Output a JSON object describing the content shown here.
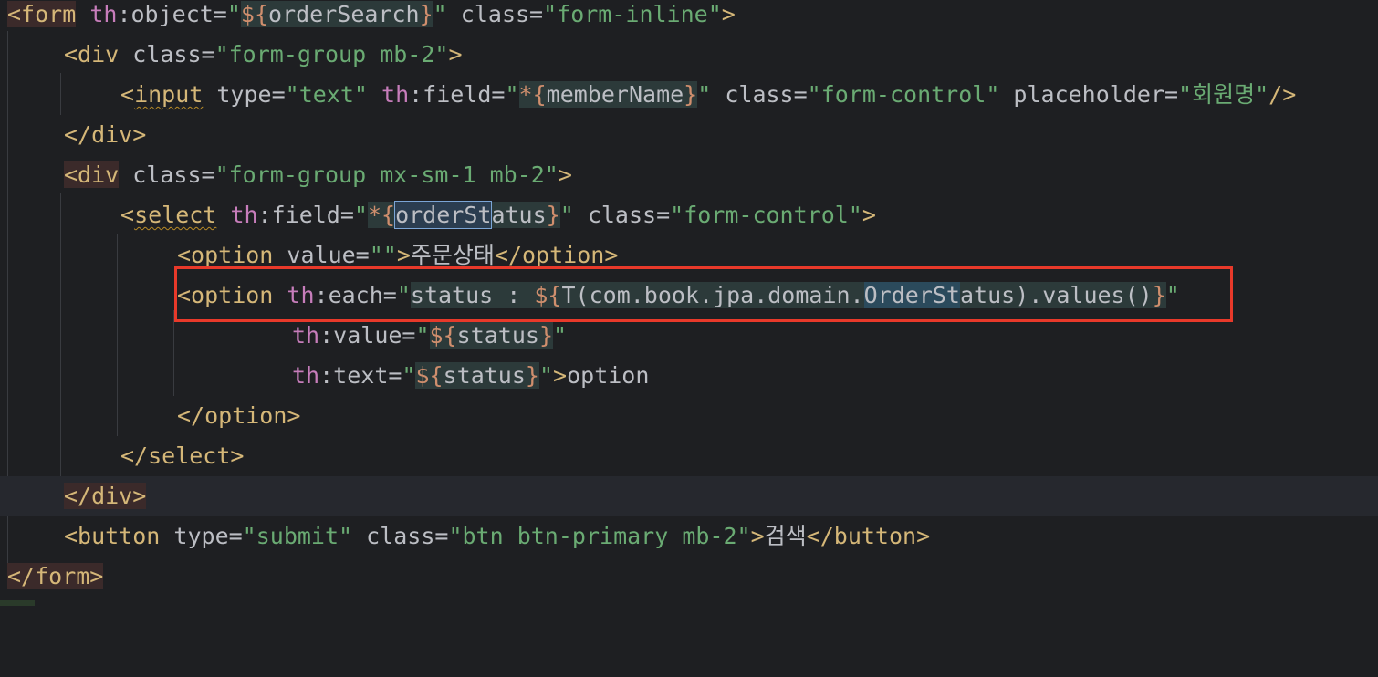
{
  "editor": {
    "lines": [
      {
        "tokens": [
          "<form",
          " ",
          "th",
          ":object=",
          "\"",
          "${",
          "orderSearch",
          "}",
          "\"",
          " class=",
          "\"form-inline\"",
          ">"
        ]
      },
      {
        "tokens": [
          "<div",
          " class=",
          "\"form-group mb-2\"",
          ">"
        ]
      },
      {
        "tokens": [
          "<",
          "input",
          " type=",
          "\"text\"",
          " ",
          "th",
          ":field=",
          "\"",
          "*{",
          "memberName",
          "}",
          "\"",
          " class=",
          "\"form-control\"",
          " placeholder=",
          "\"회원명\"",
          "/>"
        ]
      },
      {
        "tokens": [
          "</div>"
        ]
      },
      {
        "tokens": [
          "<div",
          " class=",
          "\"form-group mx-sm-1 mb-2\"",
          ">"
        ]
      },
      {
        "tokens": [
          "<",
          "select",
          " ",
          "th",
          ":field=",
          "\"",
          "*{",
          "orderSt",
          "atus",
          "}",
          "\"",
          " class=",
          "\"form-control\"",
          ">"
        ]
      },
      {
        "tokens": [
          "<option",
          " value=",
          "\"\"",
          ">",
          "주문상태",
          "</option>"
        ]
      },
      {
        "tokens": [
          "<option",
          " ",
          "th",
          ":each=",
          "\"",
          "status : ",
          "${",
          "T(com.book.jpa.domain.",
          "OrderSt",
          "atus).values()",
          "}",
          "\""
        ]
      },
      {
        "tokens": [
          "th",
          ":value=",
          "\"",
          "${",
          "status",
          "}",
          "\""
        ]
      },
      {
        "tokens": [
          "th",
          ":text=",
          "\"",
          "${",
          "status",
          "}",
          "\"",
          ">",
          "option"
        ]
      },
      {
        "tokens": [
          "</option>"
        ]
      },
      {
        "tokens": [
          "</select>"
        ]
      },
      {
        "tokens": [
          "</div>"
        ]
      },
      {
        "tokens": [
          "<button",
          " type=",
          "\"submit\"",
          " class=",
          "\"btn btn-primary mb-2\"",
          ">",
          "검색",
          "</button>"
        ]
      },
      {
        "tokens": [
          "</form>"
        ]
      }
    ]
  },
  "colors": {
    "background": "#1e1f22",
    "tag": "#d5b778",
    "namespace": "#c77dbb",
    "string": "#6aab73",
    "expression": "#cf8e6d",
    "highlight_box": "#e8392a"
  }
}
